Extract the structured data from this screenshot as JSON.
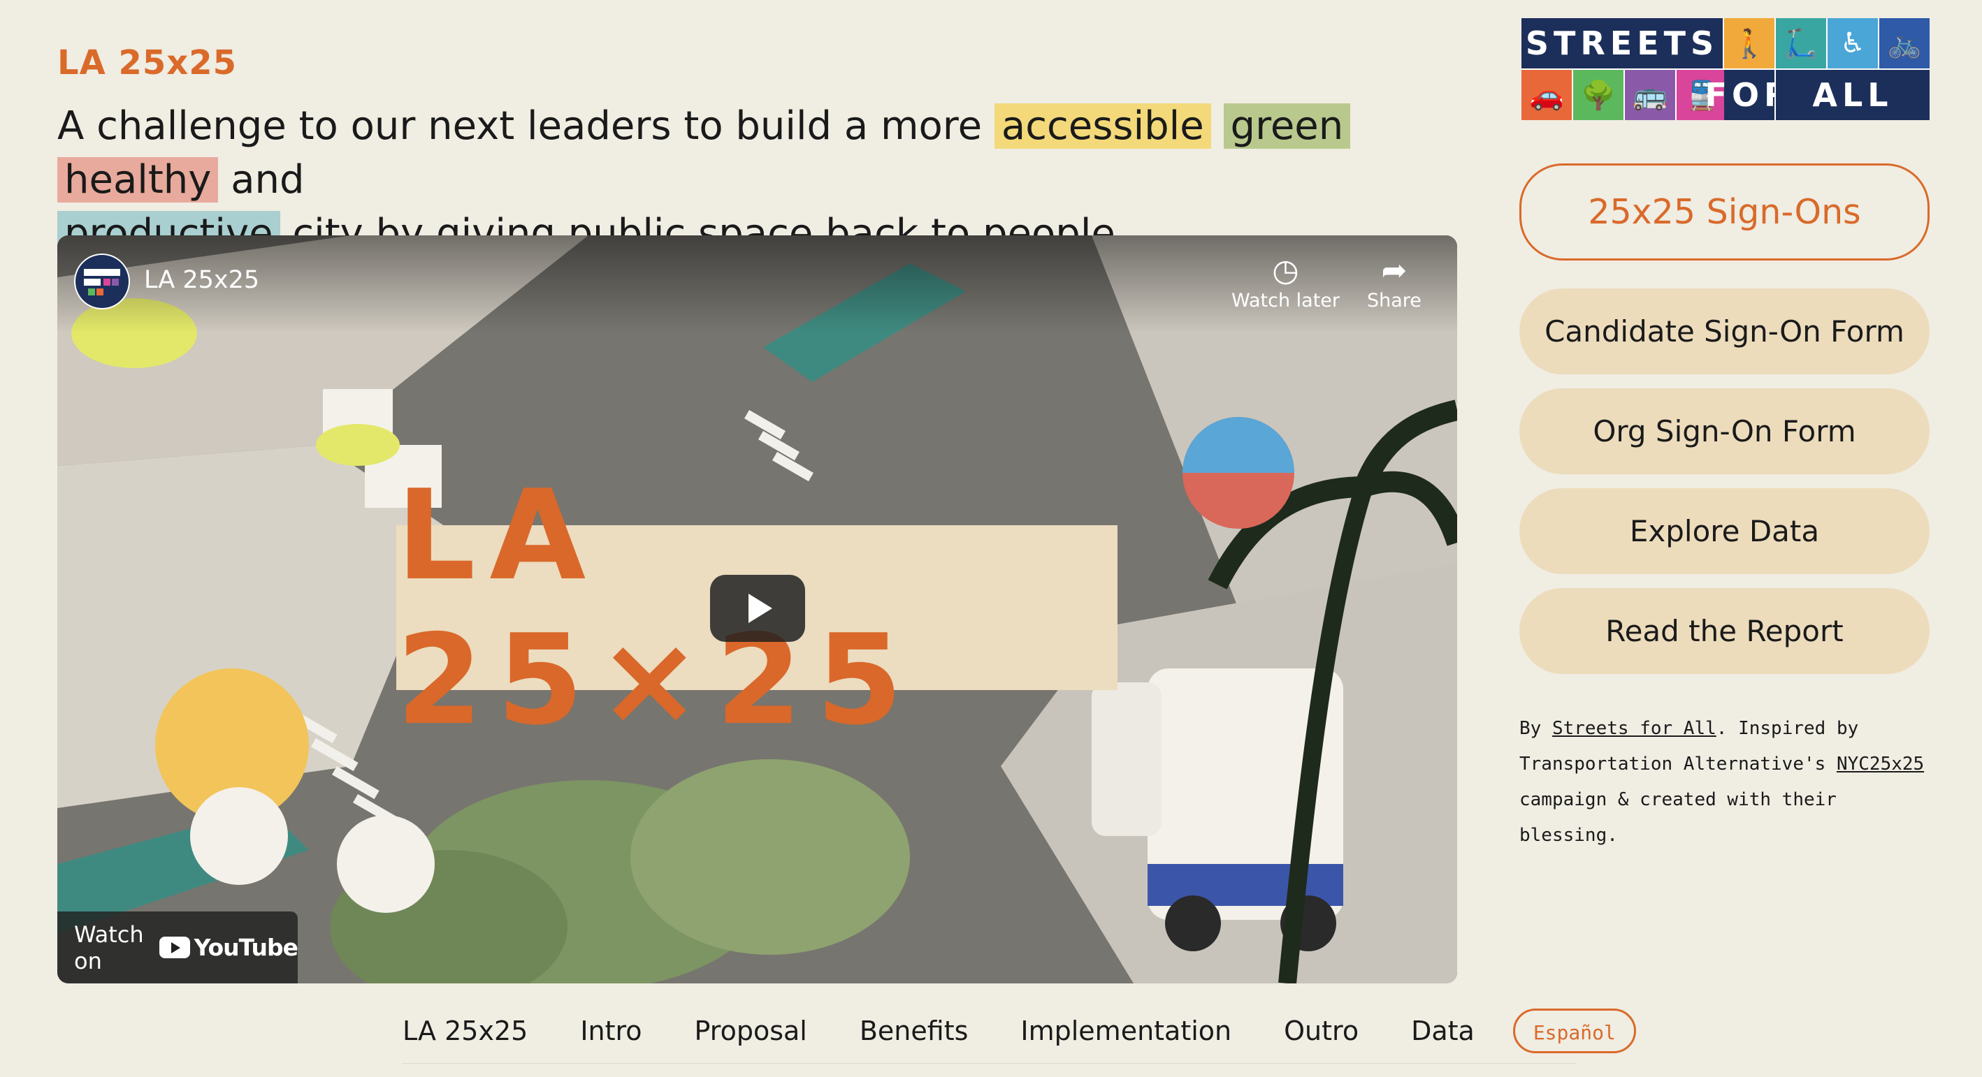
{
  "header": {
    "site_title": "LA 25x25",
    "tagline": {
      "part1": "A challenge to our next leaders to build a more",
      "accessible": "accessible",
      "green": "green",
      "healthy": "healthy",
      "and": "and",
      "productive": "productive",
      "part2": "city by giving public space back to people."
    }
  },
  "video": {
    "channel_title": "LA 25x25",
    "title_card": "LA 25×25",
    "watch_later_label": "Watch later",
    "share_label": "Share",
    "watch_on_label": "Watch on",
    "youtube_label": "YouTube"
  },
  "logo": {
    "word1": "STREETS",
    "word2": "FOR",
    "word3": "ALL",
    "tile_colors": [
      "#f0a93a",
      "#3aa6a1",
      "#4aa6d6",
      "#2e5aa8",
      "#e8683a",
      "#5cb85c",
      "#8a5aa8",
      "#d8459a"
    ],
    "word_color": "#1c2f5a"
  },
  "sidebar": {
    "primary_button": "25x25 Sign-Ons",
    "buttons": [
      "Candidate Sign-On Form",
      "Org Sign-On Form",
      "Explore Data",
      "Read the Report"
    ]
  },
  "credit": {
    "by": "By",
    "link1": "Streets for All",
    "middle": ". Inspired by Transportation Alternative's",
    "link2": "NYC25x25",
    "end": "campaign & created with their blessing."
  },
  "nav": {
    "items": [
      "LA 25x25",
      "Intro",
      "Proposal",
      "Benefits",
      "Implementation",
      "Outro",
      "Data"
    ],
    "language_button": "Español"
  },
  "colors": {
    "accent": "#d96a2a",
    "background": "#f0ede3",
    "button_fill": "#ecdcbc"
  }
}
